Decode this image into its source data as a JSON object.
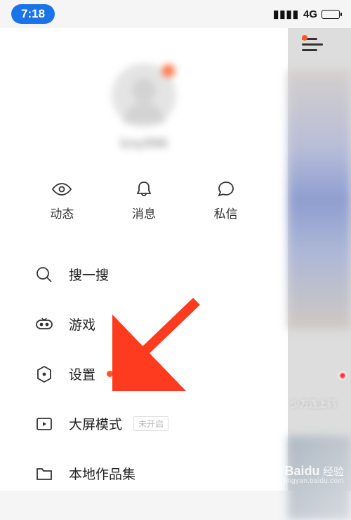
{
  "status": {
    "time": "7:18",
    "signal_label": "4G"
  },
  "profile": {
    "username": "lzxy996"
  },
  "tabs": {
    "activity": "动态",
    "notifications": "消息",
    "messages": "私信"
  },
  "menu": {
    "search": "搜一搜",
    "games": "游戏",
    "settings": "设置",
    "big_screen": "大屏模式",
    "big_screen_tag": "未开启",
    "local_works": "本地作品集"
  },
  "side_overlay_text": "少万连上码",
  "watermark": {
    "brand_en": "Baidu",
    "brand_cn": "经验",
    "url": "jingyan.baidu.com"
  },
  "colors": {
    "accent": "#ff5722",
    "primary": "#1a73e8"
  }
}
